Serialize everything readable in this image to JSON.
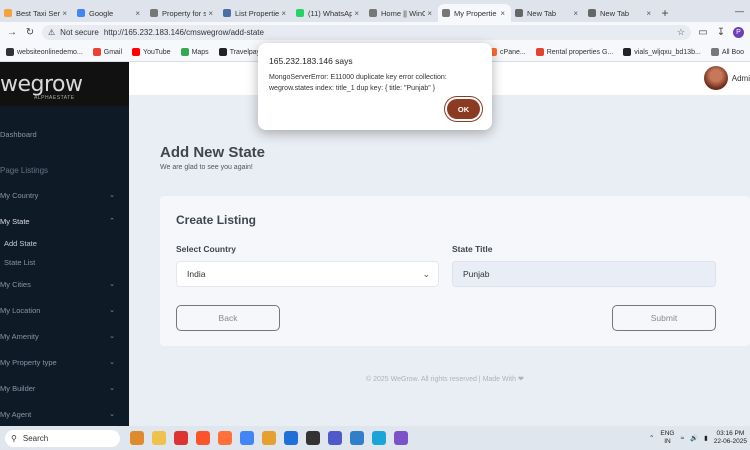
{
  "browser": {
    "tabs": [
      {
        "label": "Best Taxi Serv",
        "color": "#f2a33a"
      },
      {
        "label": "Google",
        "color": "#4285f4"
      },
      {
        "label": "Property for s",
        "color": "#777777"
      },
      {
        "label": "List Propertie",
        "color": "#4a6fa5"
      },
      {
        "label": "(11) WhatsAp",
        "color": "#25d366"
      },
      {
        "label": "Home || WinO",
        "color": "#777777"
      },
      {
        "label": "My Propertie",
        "color": "#777777"
      },
      {
        "label": "New Tab",
        "color": "#666666"
      },
      {
        "label": "New Tab",
        "color": "#666666"
      }
    ],
    "active_tab": 6,
    "not_secure": "Not secure",
    "url": "http://165.232.183.146/cmswegrow/add-state",
    "profile_initial": "P",
    "bookmarks": [
      {
        "label": "websiteonlinedemo...",
        "color": "#333333"
      },
      {
        "label": "Gmail",
        "color": "#ea4335"
      },
      {
        "label": "YouTube",
        "color": "#ff0000"
      },
      {
        "label": "Maps",
        "color": "#34a853"
      },
      {
        "label": "Travelpayouts",
        "color": "#222222"
      }
    ],
    "bookmarks_right": [
      {
        "label": "cPane...",
        "color": "#ff6c2c"
      },
      {
        "label": "Rental properties G...",
        "color": "#e2452f"
      },
      {
        "label": "vials_wljqxu_bd13b...",
        "color": "#222222"
      },
      {
        "label": "All Boo",
        "color": "#777777"
      }
    ]
  },
  "app": {
    "logo": "wegrow",
    "logo_sub": "ALPHAESTATE",
    "admin_label": "Admi",
    "sidebar": {
      "dashboard": "Dashboard",
      "section_heading": "Page Listings",
      "items": [
        {
          "label": "My Country"
        },
        {
          "label": "My State"
        },
        {
          "label": "My Cities"
        },
        {
          "label": "My Location"
        },
        {
          "label": "My Amenity"
        },
        {
          "label": "My Property type"
        },
        {
          "label": "My Builder"
        },
        {
          "label": "My Agent"
        }
      ],
      "sub_items": [
        {
          "label": "Add State"
        },
        {
          "label": "State List"
        }
      ]
    },
    "page_title": "Add New State",
    "page_subtitle": "We are glad to see you again!",
    "card_title": "Create Listing",
    "country_label": "Select Country",
    "country_value": "India",
    "state_label": "State Title",
    "state_value": "Punjab",
    "back_button": "Back",
    "submit_button": "Submit",
    "footer": "© 2025 WeGrow. All rights reserved | Made With ❤"
  },
  "dialog": {
    "title": "165.232.183.146 says",
    "message": "MongoServerError: E11000 duplicate key error collection: wegrow.states index: title_1 dup key: { title: \"Punjab\" }",
    "ok": "OK"
  },
  "taskbar": {
    "search": "Search",
    "icons": [
      "#e08a2e",
      "#f0c14b",
      "#d33",
      "#fb542b",
      "#ff7139",
      "#4285f4",
      "#e5a02f",
      "#1e6fd9",
      "#333333",
      "#5059c9",
      "#2f80c9",
      "#1aa5d8",
      "#7b52c7"
    ],
    "lang": "ENG",
    "region": "IN",
    "time": "03:16 PM",
    "date": "22-06-2025"
  },
  "colors": {
    "sidebar_bg": "#0f1a27",
    "accent_ok": "#8a3b22"
  }
}
